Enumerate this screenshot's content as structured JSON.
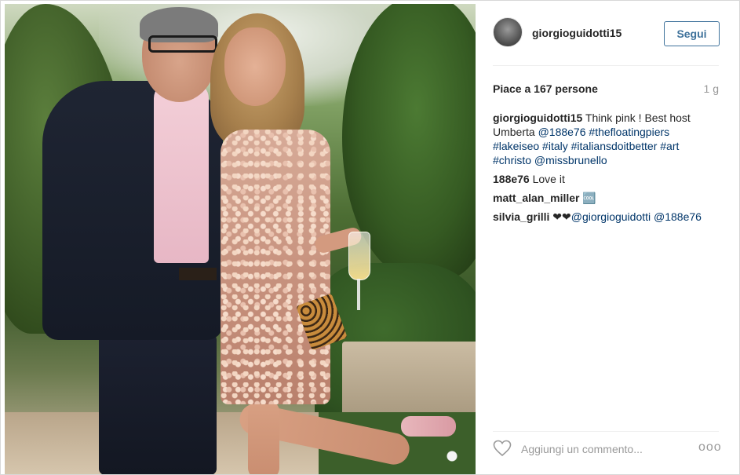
{
  "post": {
    "photo_alt": "Foto",
    "author": "giorgioguidotti15",
    "follow_label": "Segui",
    "likes_text": "Piace a 167 persone",
    "time_ago": "1 g",
    "caption": {
      "user": "giorgioguidotti15",
      "text_1": "Think pink ! Best host Umberta",
      "mention_1": "@188e76",
      "tag_1": "#thefloatingpiers",
      "tag_2": "#lakeiseo",
      "tag_3": "#italy",
      "tag_4": "#italiansdoitbetter",
      "tag_5": "#art",
      "tag_6": "#christo",
      "mention_2": "@missbrunello"
    },
    "comments": [
      {
        "user": "188e76",
        "text": "Love it"
      },
      {
        "user": "matt_alan_miller",
        "text": "🆒"
      },
      {
        "user": "silvia_grilli",
        "text": "❤❤",
        "mention_1": "@giorgioguidotti",
        "mention_2": "@188e76"
      }
    ],
    "comment_placeholder": "Aggiungi un commento...",
    "more_label": "ooo"
  },
  "colors": {
    "link": "#003569",
    "follow_border": "#3f729b",
    "muted": "#999999"
  }
}
